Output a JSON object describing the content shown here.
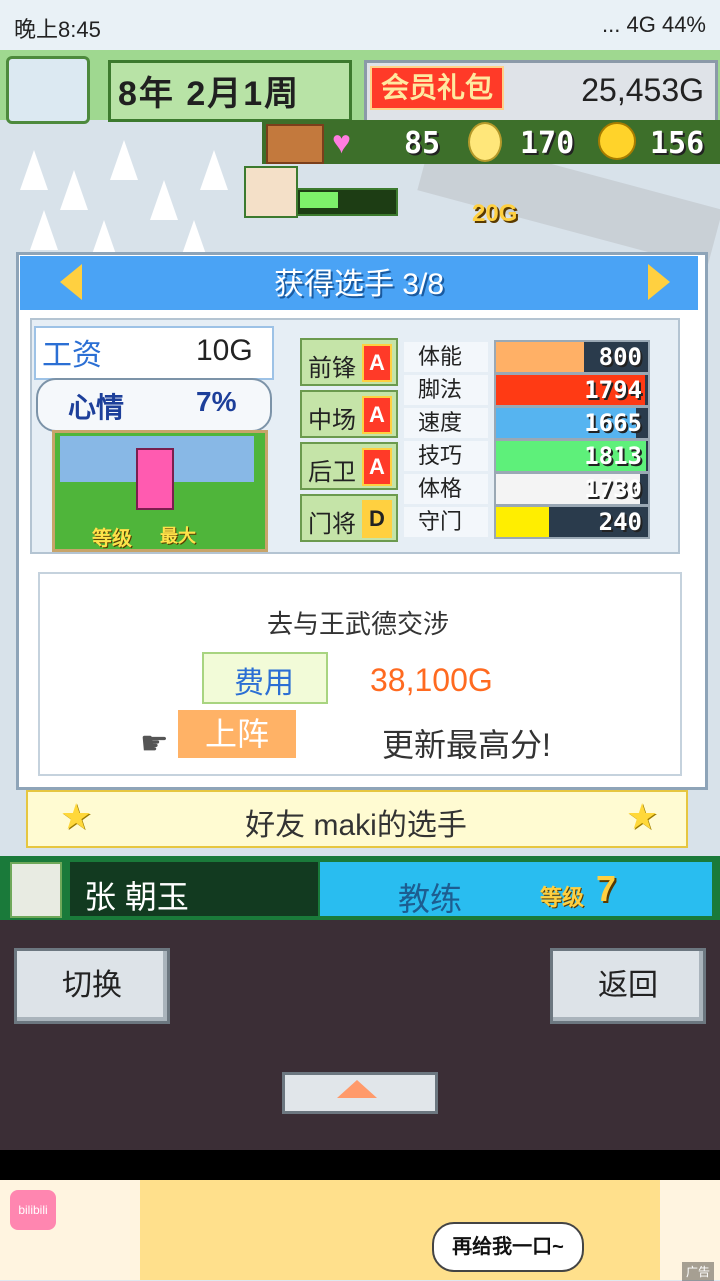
{
  "status_bar": {
    "time": "晚上8:45",
    "indicators": "... 4G 44%"
  },
  "top_bar": {
    "date": "8年 2月1周",
    "vip_label": "会员礼包",
    "money": "25,453G"
  },
  "resources": {
    "hearts": "85",
    "ideas": "170",
    "coins": "156",
    "float_income": "20G"
  },
  "panel": {
    "title": "获得选手 3/8",
    "salary_label": "工资",
    "salary_value": "10G",
    "mood_label": "心情",
    "mood_value": "7%",
    "grade_label": "等级",
    "grade_value": "最大",
    "positions": [
      {
        "name": "前锋",
        "grade": "A"
      },
      {
        "name": "中场",
        "grade": "A"
      },
      {
        "name": "后卫",
        "grade": "A"
      },
      {
        "name": "门将",
        "grade": "D"
      }
    ],
    "stats": [
      {
        "name": "体能",
        "value": "800",
        "fill": 0.58,
        "color": "#ffb066"
      },
      {
        "name": "脚法",
        "value": "1794",
        "fill": 0.98,
        "color": "#ff3a14"
      },
      {
        "name": "速度",
        "value": "1665",
        "fill": 0.92,
        "color": "#56b4f0"
      },
      {
        "name": "技巧",
        "value": "1813",
        "fill": 0.99,
        "color": "#5ef07a"
      },
      {
        "name": "体格",
        "value": "1730",
        "fill": 0.95,
        "color": "#f4f4f4"
      },
      {
        "name": "守门",
        "value": "240",
        "fill": 0.35,
        "color": "#ffee00"
      }
    ],
    "negotiation_title": "去与王武德交涉",
    "fee_label": "费用",
    "fee_value": "38,100G",
    "confirm_label": "上阵",
    "record_text": "更新最高分!"
  },
  "friend_bar": {
    "text": "好友 maki的选手"
  },
  "coach": {
    "name": "张 朝玉",
    "role": "教练",
    "grade_label": "等级",
    "grade": "7"
  },
  "buttons": {
    "switch": "切换",
    "back": "返回"
  },
  "ad": {
    "bubble": "再给我一口~",
    "logo": "bilibili",
    "tag": "广告"
  }
}
